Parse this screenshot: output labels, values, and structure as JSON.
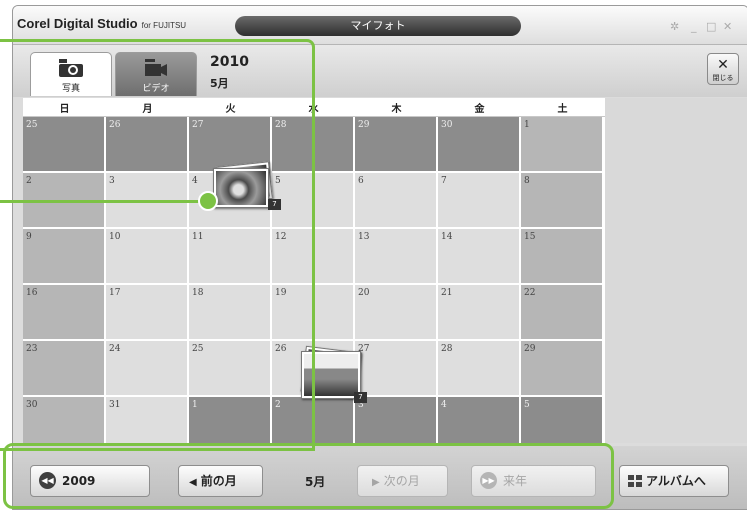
{
  "app": {
    "name": "Corel Digital Studio",
    "name_suffix": "for FUJITSU",
    "title": "マイフォト",
    "window_controls": [
      "minimize",
      "maximize",
      "close"
    ]
  },
  "toolbar": {
    "tabs": [
      {
        "label": "写真",
        "icon": "camera-icon",
        "selected": true
      },
      {
        "label": "ビデオ",
        "icon": "video-camera-icon",
        "selected": false
      }
    ],
    "year": "2010",
    "month": "5月",
    "close_label": "閉じる"
  },
  "calendar": {
    "weekdays": [
      "日",
      "月",
      "火",
      "水",
      "木",
      "金",
      "土"
    ],
    "weeks": [
      [
        "25",
        "26",
        "27",
        "28",
        "29",
        "30",
        "1"
      ],
      [
        "2",
        "3",
        "4",
        "5",
        "6",
        "7",
        "8"
      ],
      [
        "9",
        "10",
        "11",
        "12",
        "13",
        "14",
        "15"
      ],
      [
        "16",
        "17",
        "18",
        "19",
        "20",
        "21",
        "22"
      ],
      [
        "23",
        "24",
        "25",
        "26",
        "27",
        "28",
        "29"
      ],
      [
        "30",
        "31",
        "1",
        "2",
        "3",
        "4",
        "5"
      ]
    ],
    "photo_days": [
      {
        "day": "4",
        "count": "7"
      },
      {
        "day": "26",
        "count": "7"
      }
    ]
  },
  "bottom": {
    "prev_year": "2009",
    "prev_month": "前の月",
    "current_month": "5月",
    "next_month": "次の月",
    "next_year": "来年",
    "album": "アルバムへ"
  },
  "colors": {
    "highlight": "#7cc244",
    "outside_month_cell": "#8c8c8c",
    "weekend_cell": "#b6b6b6",
    "weekday_cell": "#dedede"
  }
}
